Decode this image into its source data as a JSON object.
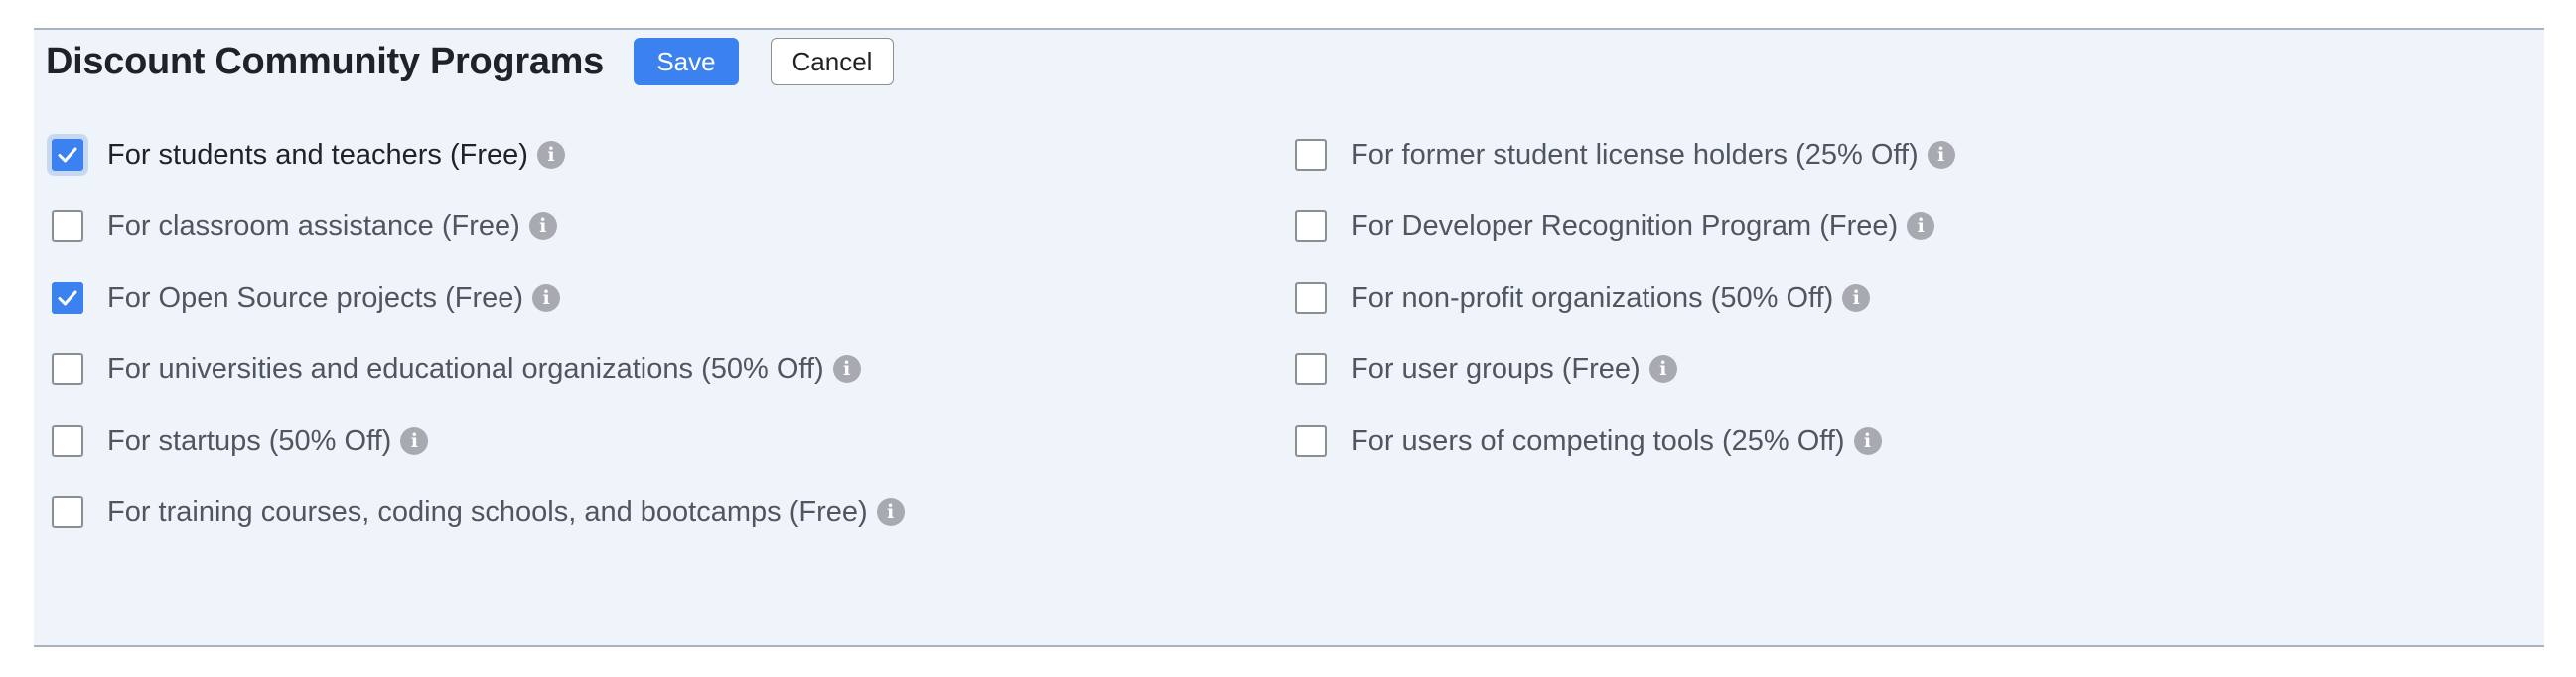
{
  "section": {
    "title": "Discount Community Programs",
    "save_label": "Save",
    "cancel_label": "Cancel"
  },
  "info_glyph": "i",
  "left_options": [
    {
      "label": "For students and teachers (Free)",
      "checked": true,
      "focused": true
    },
    {
      "label": "For classroom assistance (Free)",
      "checked": false
    },
    {
      "label": "For Open Source projects (Free)",
      "checked": true
    },
    {
      "label": "For universities and educational organizations (50% Off)",
      "checked": false
    },
    {
      "label": "For startups (50% Off)",
      "checked": false
    },
    {
      "label": "For training courses, coding schools, and bootcamps (Free)",
      "checked": false
    }
  ],
  "right_options": [
    {
      "label": "For former student license holders (25% Off)",
      "checked": false
    },
    {
      "label": "For Developer Recognition Program (Free)",
      "checked": false
    },
    {
      "label": "For non-profit organizations (50% Off)",
      "checked": false
    },
    {
      "label": "For user groups (Free)",
      "checked": false
    },
    {
      "label": "For users of competing tools (25% Off)",
      "checked": false
    }
  ],
  "colors": {
    "accent": "#3b82f0",
    "panel_background": "#eff4fb",
    "info_icon": "#a7abb1"
  }
}
